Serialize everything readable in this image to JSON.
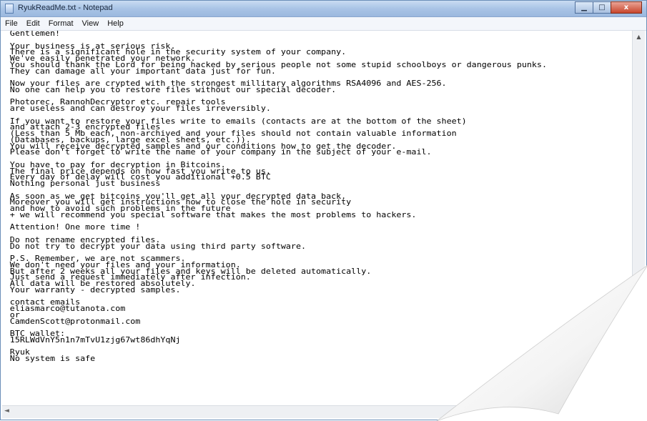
{
  "window": {
    "title": "RyukReadMe.txt - Notepad",
    "controls": {
      "minimize": "▁",
      "maximize": "□",
      "close": "x"
    }
  },
  "menu": [
    "File",
    "Edit",
    "Format",
    "View",
    "Help"
  ],
  "document": {
    "lines": [
      "Gentlemen!",
      "",
      "Your business is at serious risk.",
      "There is a significant hole in the security system of your company.",
      "We've easily penetrated your network.",
      "You should thank the Lord for being hacked by serious people not some stupid schoolboys or dangerous punks.",
      "They can damage all your important data just for fun.",
      "",
      "Now your files are crypted with the strongest millitary algorithms RSA4096 and AES-256.",
      "No one can help you to restore files without our special decoder.",
      "",
      "Photorec, RannohDecryptor etc. repair tools",
      "are useless and can destroy your files irreversibly.",
      "",
      "If you want to restore your files write to emails (contacts are at the bottom of the sheet)",
      "and attach 2-3 encrypted files",
      "(Less than 5 Mb each, non-archived and your files should not contain valuable information",
      "(Databases, backups, large excel sheets, etc.)).",
      "You will receive decrypted samples and our conditions how to get the decoder.",
      "Please don't forget to write the name of your company in the subject of your e-mail.",
      "",
      "You have to pay for decryption in Bitcoins.",
      "The final price depends on how fast you write to us.",
      "Every day of delay will cost you additional +0.5 BTC",
      "Nothing personal just business",
      "",
      "As soon as we get bitcoins you'll get all your decrypted data back.",
      "Moreover you will get instructions how to close the hole in security",
      "and how to avoid such problems in the future",
      "+ we will recommend you special software that makes the most problems to hackers.",
      "",
      "Attention! One more time !",
      "",
      "Do not rename encrypted files.",
      "Do not try to decrypt your data using third party software.",
      "",
      "P.S. Remember, we are not scammers.",
      "We don't need your files and your information.",
      "But after 2 weeks all your files and keys will be deleted automatically.",
      "Just send a request immediately after infection.",
      "All data will be restored absolutely.",
      "Your warranty - decrypted samples.",
      "",
      "contact emails",
      "eliasmarco@tutanota.com",
      "or",
      "CamdenScott@protonmail.com",
      "",
      "BTC wallet:",
      "15RLWdVnY5n1n7mTvU1zjg67wt86dhYqNj",
      "",
      "Ryuk",
      "No system is safe"
    ]
  },
  "colors": {
    "titlebar": "#a9c4e6",
    "close_button": "#c9462c",
    "text": "#000000"
  }
}
